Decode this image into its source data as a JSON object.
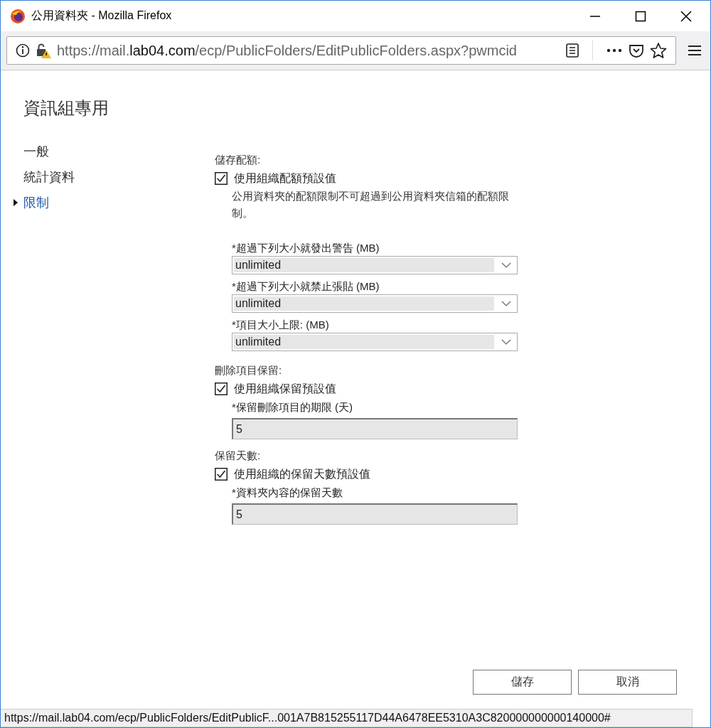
{
  "window": {
    "title": "公用資料夾 - Mozilla Firefox"
  },
  "address_bar": {
    "url_host": "https://mail.",
    "url_domain": "lab04.com",
    "url_path": "/ecp/PublicFolders/EditPublicFolders.aspx?pwmcid"
  },
  "page_title": "資訊組專用",
  "nav": [
    {
      "label": "一般",
      "selected": false
    },
    {
      "label": "統計資料",
      "selected": false
    },
    {
      "label": "限制",
      "selected": true
    }
  ],
  "sections": [
    {
      "heading": "儲存配額:",
      "checkbox": {
        "label": "使用組織配額預設值",
        "checked": true
      },
      "note": "公用資料夾的配額限制不可超過到公用資料夾信箱的配額限制。",
      "fields": [
        {
          "kind": "dropdown",
          "label": "*超過下列大小就發出警告 (MB)",
          "value": "unlimited",
          "disabled": true
        },
        {
          "kind": "dropdown",
          "label": "*超過下列大小就禁止張貼 (MB)",
          "value": "unlimited",
          "disabled": true
        },
        {
          "kind": "dropdown",
          "label": "*項目大小上限: (MB)",
          "value": "unlimited",
          "disabled": true
        }
      ]
    },
    {
      "heading": "刪除項目保留:",
      "checkbox": {
        "label": "使用組織保留預設值",
        "checked": true
      },
      "fields": [
        {
          "kind": "text",
          "label": "*保留刪除項目的期限 (天)",
          "value": "5",
          "disabled": true
        }
      ]
    },
    {
      "heading": "保留天數:",
      "checkbox": {
        "label": "使用組織的保留天數預設值",
        "checked": true
      },
      "fields": [
        {
          "kind": "text",
          "label": "*資料夾內容的保留天數",
          "value": "5",
          "disabled": true
        }
      ]
    }
  ],
  "buttons": [
    "儲存",
    "取消"
  ],
  "status_bar": "https://mail.lab04.com/ecp/PublicFolders/EditPublicF...001A7B815255117D44A6478EE5310A3C820000000000140000#"
}
